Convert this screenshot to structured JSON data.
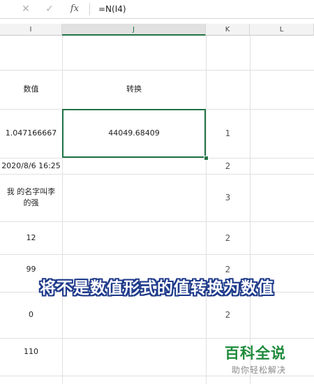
{
  "formula_bar": {
    "cancel_icon": "✕",
    "confirm_icon": "✓",
    "fx_label": "fx",
    "formula": "=N(I4)"
  },
  "columns": [
    "I",
    "J",
    "K",
    "L"
  ],
  "rows": [
    {
      "i": "",
      "j": "",
      "k": ""
    },
    {
      "i": "数值",
      "j": "转换",
      "k": ""
    },
    {
      "i": "1.047166667",
      "j": "44049.68409",
      "k": "1"
    },
    {
      "i": "2020/8/6 16:25",
      "j": "",
      "k": "2"
    },
    {
      "i": "我    的名字叫李的强",
      "j": "",
      "k": "3"
    },
    {
      "i": "12",
      "j": "",
      "k": "2"
    },
    {
      "i": "99",
      "j": "",
      "k": "2"
    },
    {
      "i": "0",
      "j": "",
      "k": "2"
    },
    {
      "i": "110",
      "j": "",
      "k": ""
    }
  ],
  "caption": "将不是数值形式的值转换为数值",
  "watermark": {
    "title": "百科全说",
    "subtitle": "助你轻松解决"
  },
  "colors": {
    "accent": "#217346",
    "watermark": "#1f8b3c",
    "caption_outline": "#1e3a8a"
  }
}
